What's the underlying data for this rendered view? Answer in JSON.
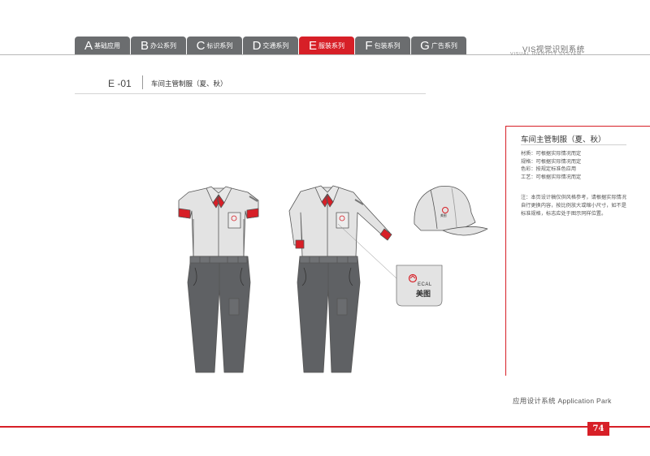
{
  "tabs": [
    {
      "letter": "A",
      "label": "基础应用"
    },
    {
      "letter": "B",
      "label": "办公系列"
    },
    {
      "letter": "C",
      "label": "标识系列"
    },
    {
      "letter": "D",
      "label": "交通系列"
    },
    {
      "letter": "E",
      "label": "服装系列"
    },
    {
      "letter": "F",
      "label": "包装系列"
    },
    {
      "letter": "G",
      "label": "广告系列"
    }
  ],
  "active_tab": "E",
  "header": {
    "vis_cn": "VIS视觉识别系统",
    "vis_en": "VISUAL IDENTITY SYSTEM"
  },
  "section": {
    "code": "E -01",
    "title": "车间主管制服（夏、秋）"
  },
  "right_panel": {
    "title": "车间主管制服（夏、秋）",
    "specs": [
      "材质：可根据实际情况而定",
      "规格：可根据实际情况而定",
      "色彩：按规定标准色应用",
      "工艺：可根据实际情况而定"
    ],
    "note": "注：本页设计稿仅供风格参考，请根据实际情况自行更换内容，按比例放大或缩小尺寸，如不是标准规格，标志应处于图示同样位置。"
  },
  "logo": {
    "text_en": "ECAL",
    "text_cn": "美图"
  },
  "footer": {
    "app_label": "应用设计系统  Application Park",
    "page_number": "74"
  },
  "colors": {
    "accent": "#d71f27",
    "tab_gray": "#6b6d6f",
    "shirt": "#e3e3e3",
    "pants": "#5f6164"
  }
}
